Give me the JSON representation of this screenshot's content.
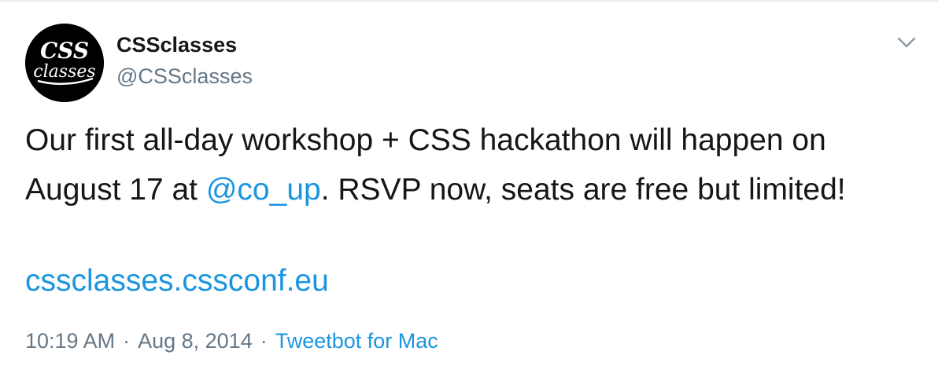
{
  "user": {
    "display_name": "CSSclasses",
    "handle": "@CSSclasses",
    "avatar_icon": "cssclasses-logo-icon"
  },
  "tweet": {
    "text_part1": "Our first all-day workshop + CSS hackathon will happen on August 17 at ",
    "mention": "@co_up",
    "text_part2": ". RSVP now, seats are free but limited!",
    "link": "cssclasses.cssconf.eu"
  },
  "meta": {
    "time": "10:19 AM",
    "separator": "·",
    "date": "Aug 8, 2014",
    "source": "Tweetbot for Mac"
  },
  "menu": {
    "icon": "chevron-down-icon"
  },
  "colors": {
    "link": "#1b95e0",
    "secondary_text": "#657786",
    "primary_text": "#14171a"
  }
}
